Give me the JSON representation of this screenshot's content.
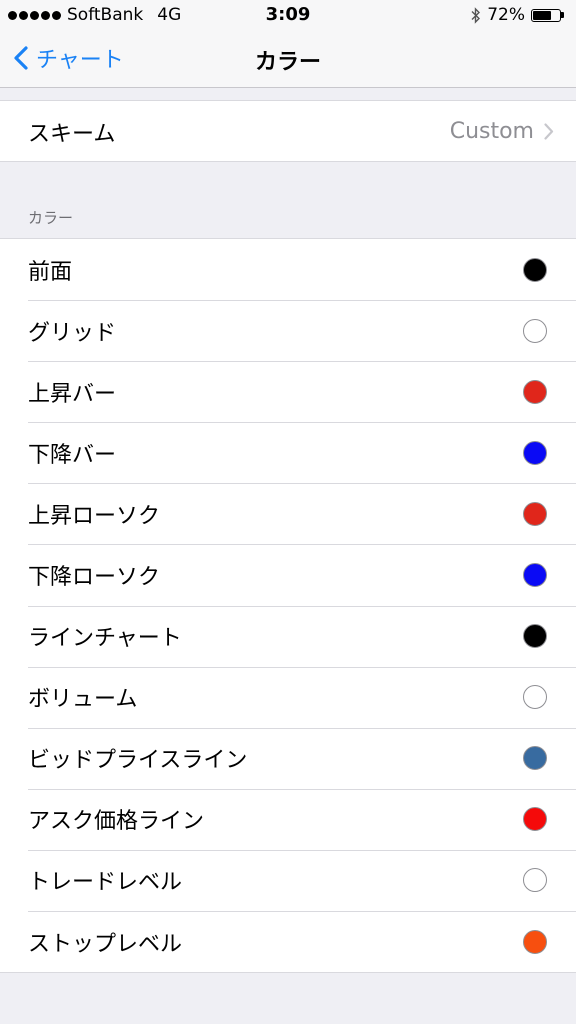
{
  "status_bar": {
    "carrier": "SoftBank",
    "network": "4G",
    "time": "3:09",
    "battery_percent": "72%",
    "battery_level": 0.72,
    "bluetooth_icon": "bluetooth-icon"
  },
  "nav": {
    "back_label": "チャート",
    "title": "カラー"
  },
  "scheme": {
    "label": "スキーム",
    "value": "Custom"
  },
  "colors_section": {
    "header": "カラー",
    "items": [
      {
        "label": "前面",
        "color": "#000000"
      },
      {
        "label": "グリッド",
        "color": "#ffffff"
      },
      {
        "label": "上昇バー",
        "color": "#e0261b"
      },
      {
        "label": "下降バー",
        "color": "#0a0af5"
      },
      {
        "label": "上昇ローソク",
        "color": "#e0261b"
      },
      {
        "label": "下降ローソク",
        "color": "#0a0af5"
      },
      {
        "label": "ラインチャート",
        "color": "#000000"
      },
      {
        "label": "ボリューム",
        "color": "#ffffff"
      },
      {
        "label": "ビッドプライスライン",
        "color": "#386ba0"
      },
      {
        "label": "アスク価格ライン",
        "color": "#f50a0a"
      },
      {
        "label": "トレードレベル",
        "color": "#ffffff"
      },
      {
        "label": "ストップレベル",
        "color": "#f74f0f"
      }
    ]
  }
}
